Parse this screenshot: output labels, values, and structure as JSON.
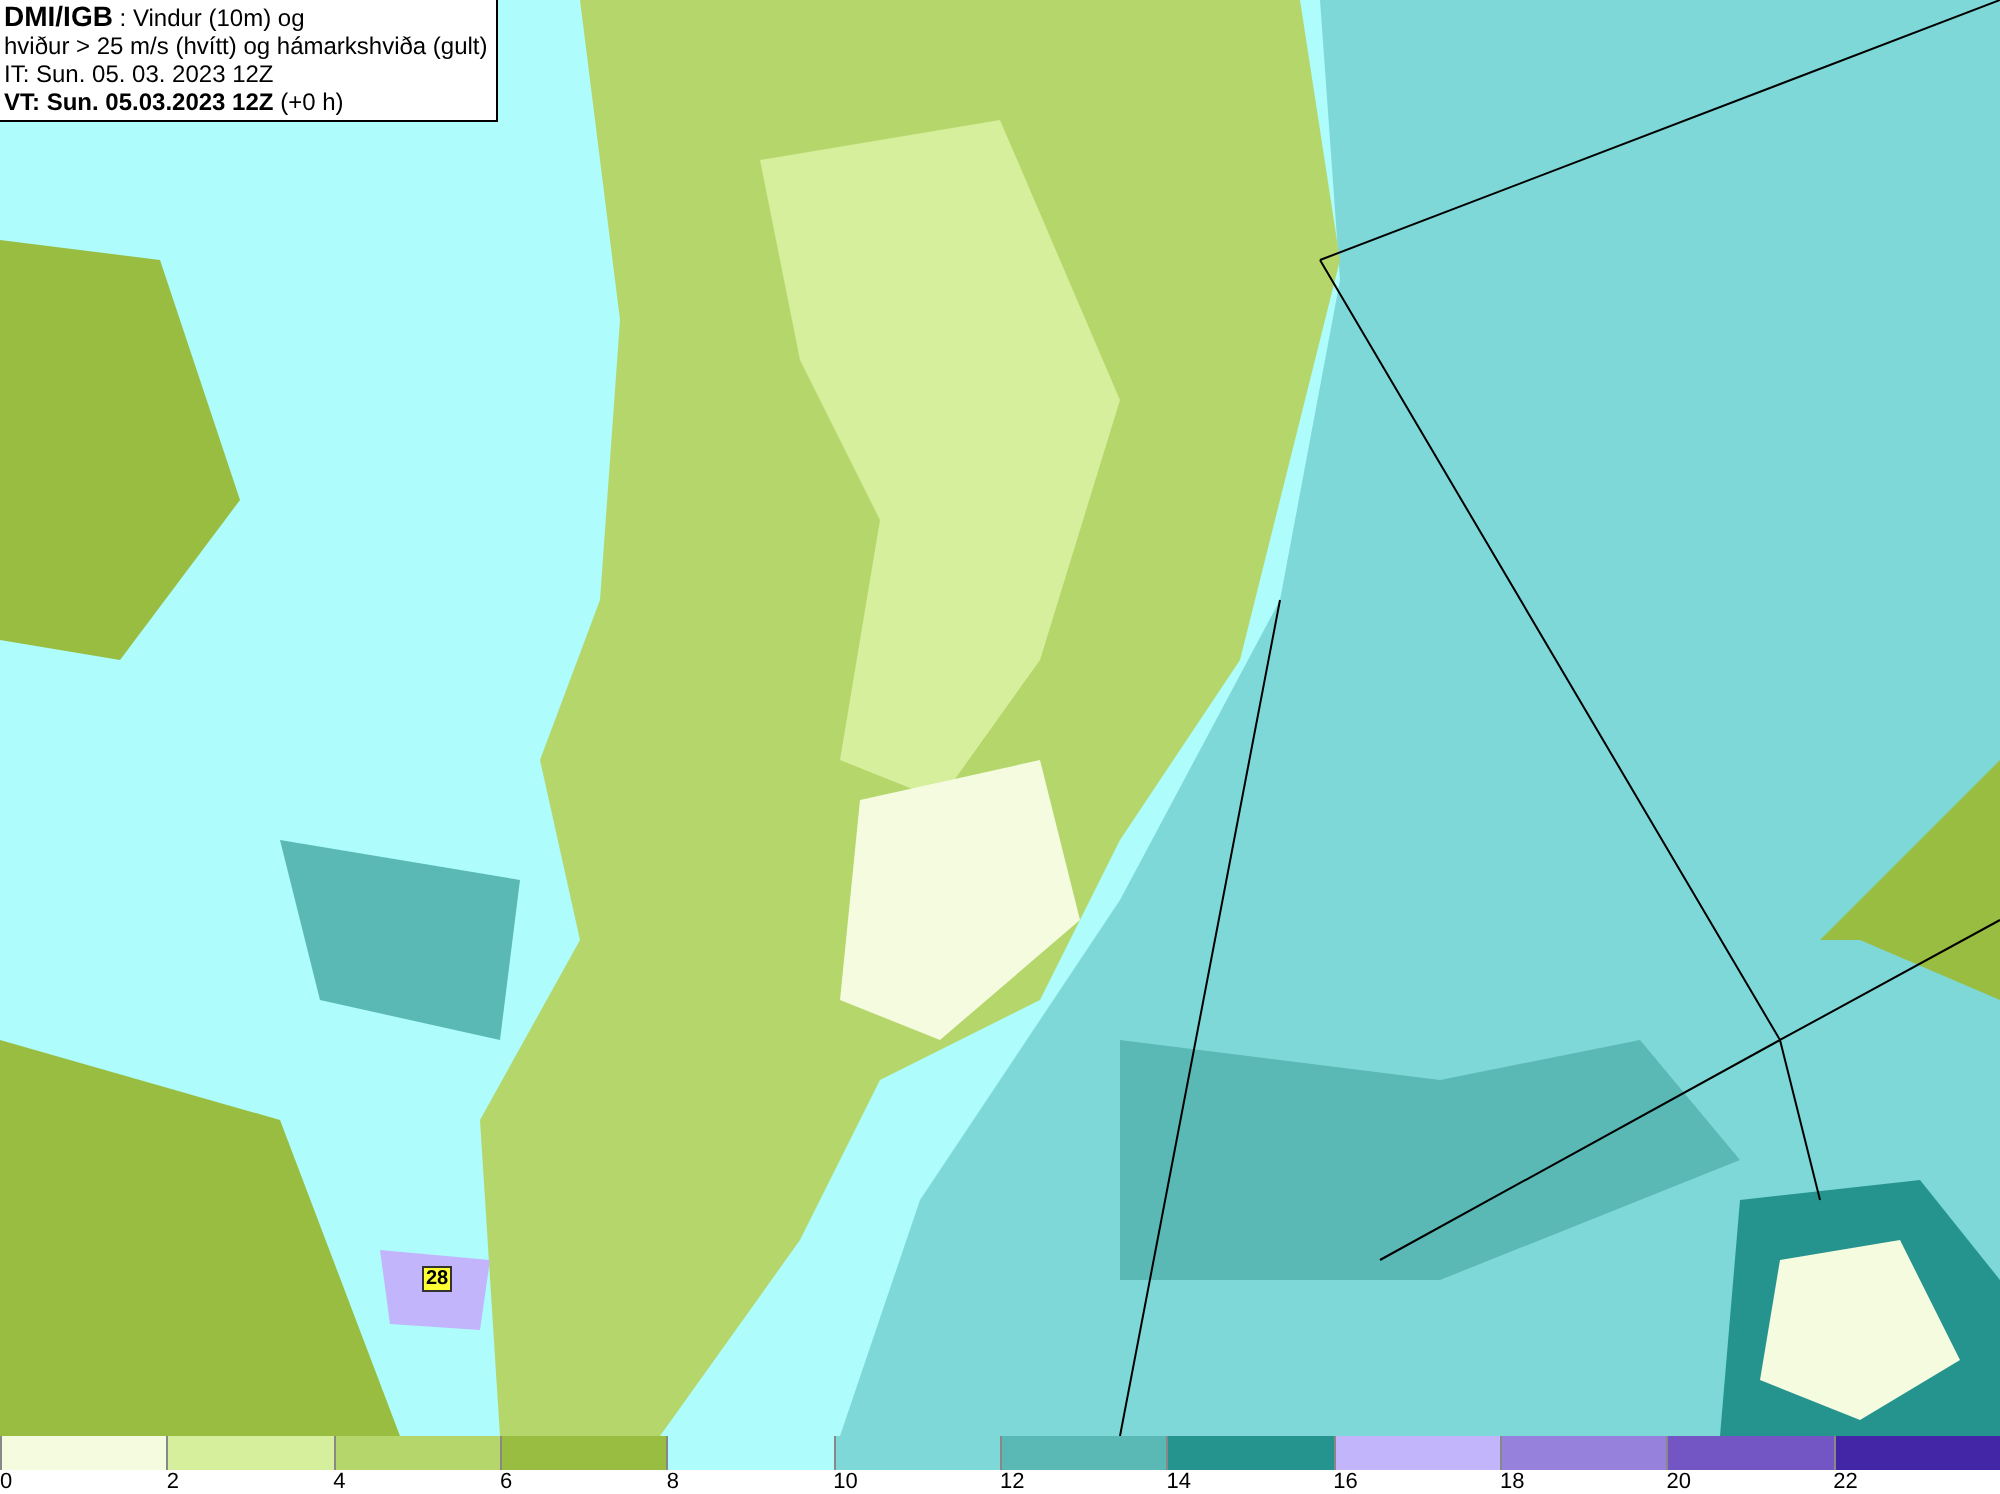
{
  "header": {
    "lines": [
      "**DMI/IGB** : Vindur (10m) og",
      "hviður > 25 m/s (hvítt) og hámarkshviða (gult)",
      "IT: Sun. 05. 03. 2023 12Z",
      "**VT: Sun. 05.03.2023 12Z** (+0 h)"
    ]
  },
  "map": {
    "gust_labels": [
      {
        "text": "28"
      }
    ]
  },
  "legend": {
    "bins": [
      {
        "color": "#f4fbdf"
      },
      {
        "color": "#d6ef9c"
      },
      {
        "color": "#b5d66b"
      },
      {
        "color": "#98bd40"
      },
      {
        "color": "#aefcfc"
      },
      {
        "color": "#7fd8d8"
      },
      {
        "color": "#5ab8b5"
      },
      {
        "color": "#25948f"
      },
      {
        "color": "#c3b5fb"
      },
      {
        "color": "#9682dc"
      },
      {
        "color": "#7455c4"
      },
      {
        "color": "#4326a6"
      }
    ],
    "ticks": [
      "0",
      "2",
      "4",
      "6",
      "8",
      "10",
      "12",
      "14",
      "16",
      "18",
      "20",
      "22"
    ]
  }
}
